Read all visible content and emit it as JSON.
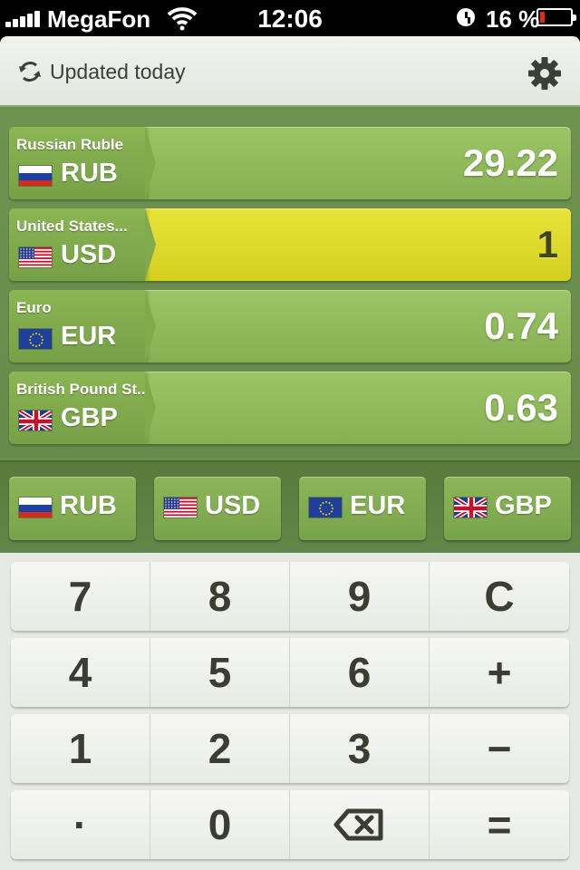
{
  "status_bar": {
    "carrier": "MegaFon",
    "time": "12:06",
    "battery": "16 %",
    "battery_level": 0.16
  },
  "header": {
    "updated_text": "Updated today",
    "icons": [
      "refresh-icon",
      "gear-icon"
    ]
  },
  "rates": [
    {
      "name": "Russian Ruble",
      "code": "RUB",
      "value": "29.22",
      "flag": "ru",
      "selected": false
    },
    {
      "name": "United States...",
      "code": "USD",
      "value": "1",
      "flag": "us",
      "selected": true
    },
    {
      "name": "Euro",
      "code": "EUR",
      "value": "0.74",
      "flag": "eu",
      "selected": false
    },
    {
      "name": "British Pound St...",
      "code": "GBP",
      "value": "0.63",
      "flag": "gb",
      "selected": false
    }
  ],
  "quick_currencies": [
    {
      "code": "RUB",
      "flag": "ru"
    },
    {
      "code": "USD",
      "flag": "us"
    },
    {
      "code": "EUR",
      "flag": "eu"
    },
    {
      "code": "GBP",
      "flag": "gb"
    }
  ],
  "keypad": [
    [
      "7",
      "8",
      "9",
      "C"
    ],
    [
      "4",
      "5",
      "6",
      "+"
    ],
    [
      "1",
      "2",
      "3",
      "−"
    ],
    [
      "·",
      "0",
      "",
      "="
    ]
  ],
  "colors": {
    "app_green": "#6c8f4f",
    "row_green": "#9cc566",
    "selected_yellow": "#e9e43a",
    "keypad_bg": "#e6e9e3"
  }
}
